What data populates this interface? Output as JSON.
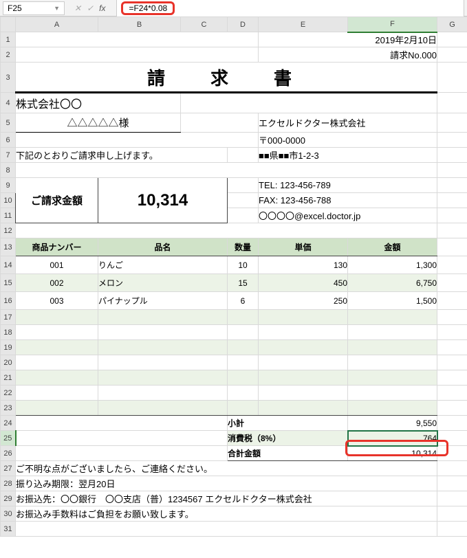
{
  "formula_bar": {
    "cell_ref": "F25",
    "formula": "=F24*0.08",
    "cancel": "✕",
    "confirm": "✓",
    "fx": "fx"
  },
  "columns": [
    "A",
    "B",
    "C",
    "D",
    "E",
    "F",
    "G"
  ],
  "rows_visible": 31,
  "date": "2019年2月10日",
  "doc_no": "請求No.000",
  "title": "請　求　書",
  "customer_company": "株式会社〇〇",
  "customer_honorific": "△△△△△様",
  "intro": "下記のとおりご請求申し上げます。",
  "vendor": {
    "name": "エクセルドクター株式会社",
    "postal": "〒000-0000",
    "address": "■■県■■市1-2-3",
    "tel": "TEL: 123-456-789",
    "fax": "FAX: 123-456-788",
    "email": "〇〇〇〇@excel.doctor.jp"
  },
  "total_label": "ご請求金額",
  "total_value": "10,314",
  "table_headers": {
    "no": "商品ナンバー",
    "name": "品名",
    "qty": "数量",
    "unit": "単価",
    "amount": "金額"
  },
  "items": [
    {
      "no": "001",
      "name": "りんご",
      "qty": "10",
      "unit": "130",
      "amount": "1,300"
    },
    {
      "no": "002",
      "name": "メロン",
      "qty": "15",
      "unit": "450",
      "amount": "6,750"
    },
    {
      "no": "003",
      "name": "パイナップル",
      "qty": "6",
      "unit": "250",
      "amount": "1,500"
    }
  ],
  "subtotal_label": "小計",
  "subtotal": "9,550",
  "tax_label": "消費税（8%）",
  "tax": "764",
  "grand_label": "合計金額",
  "grand": "10,314",
  "footer": {
    "l1": "ご不明な点がございましたら、ご連絡ください。",
    "l2": "振り込み期限：翌月20日",
    "l3": "お振込先：〇〇銀行　〇〇支店（普）1234567 エクセルドクター株式会社",
    "l4": "お振込み手数料はご負担をお願い致します。"
  }
}
